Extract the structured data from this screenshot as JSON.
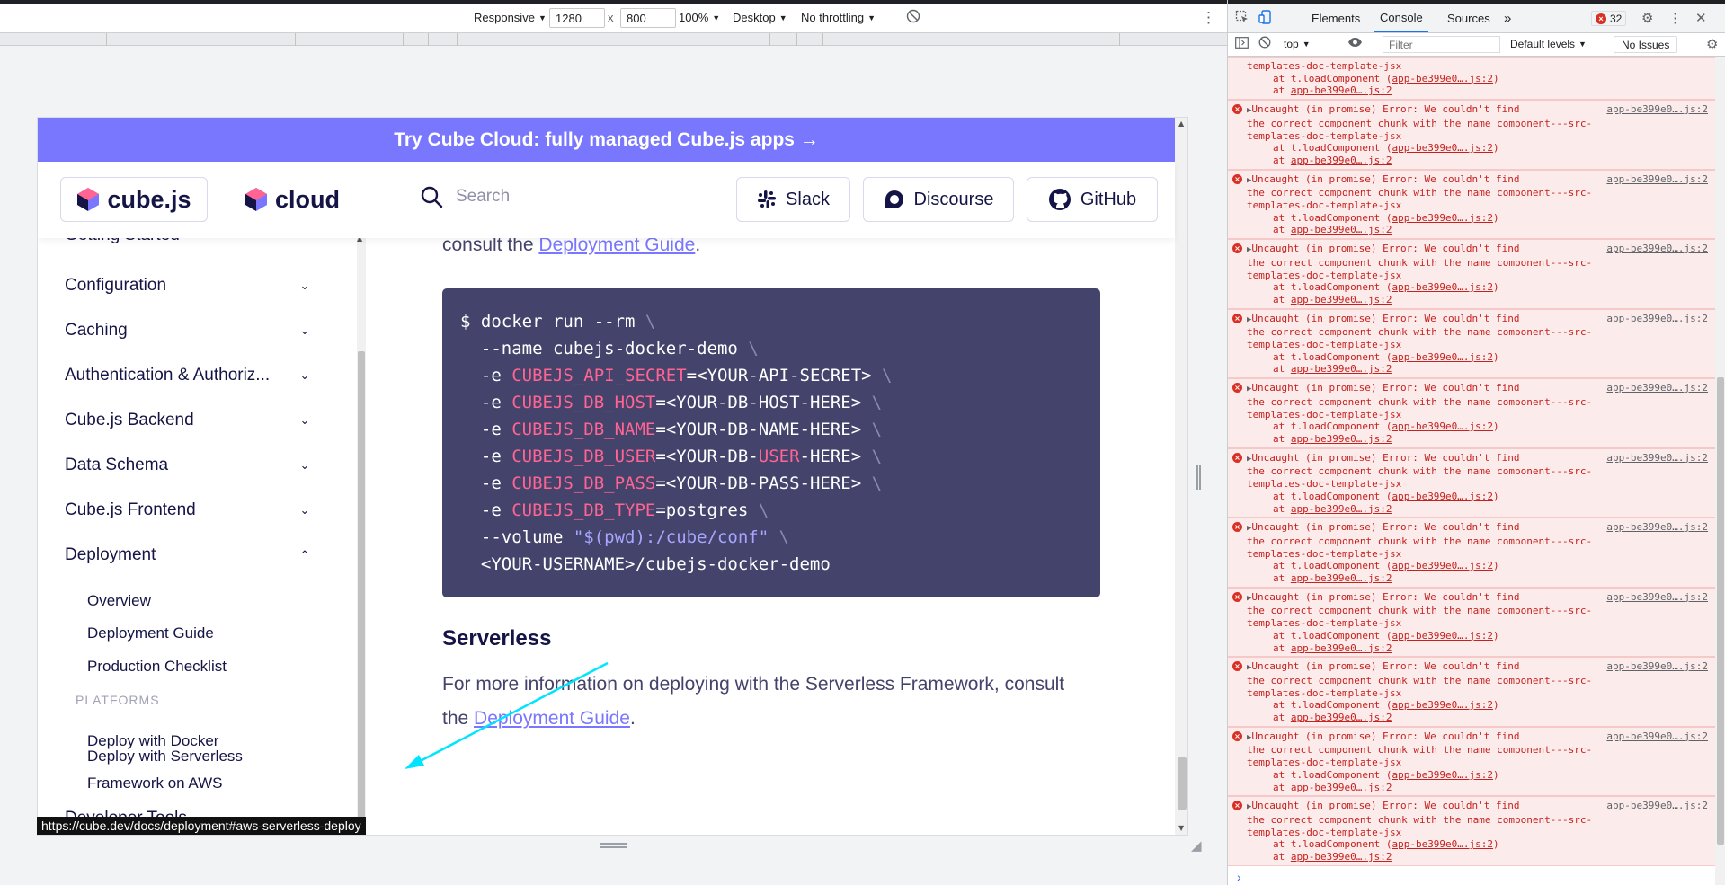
{
  "device_toolbar": {
    "device": "Responsive",
    "width": "1280",
    "height": "800",
    "times": "x",
    "zoom": "100%",
    "mode": "Desktop",
    "throttling": "No throttling"
  },
  "page": {
    "banner": "Try Cube Cloud: fully managed Cube.js apps →",
    "logo_cubejs": "cube.js",
    "logo_cloud": "cloud",
    "search_placeholder": "Search",
    "buttons": {
      "slack": "Slack",
      "discourse": "Discourse",
      "github": "GitHub"
    },
    "sidebar": {
      "cut_top": "Getting Started",
      "items": [
        {
          "label": "Configuration"
        },
        {
          "label": "Caching"
        },
        {
          "label": "Authentication & Authoriz..."
        },
        {
          "label": "Cube.js Backend"
        },
        {
          "label": "Data Schema"
        },
        {
          "label": "Cube.js Frontend"
        },
        {
          "label": "Deployment"
        }
      ],
      "sub_items": [
        "Overview",
        "Deployment Guide",
        "Production Checklist"
      ],
      "platforms_heading": "PLATFORMS",
      "platform_items": [
        "Deploy with Docker",
        "Deploy with Serverless",
        "Framework on AWS"
      ],
      "developer_tools": "Developer Tools"
    },
    "main": {
      "top_para_prefix": "consult the ",
      "top_para_link": "Deployment Guide",
      "top_para_suffix": ".",
      "code": {
        "l1": "$ docker run --rm",
        "bs": "\\",
        "l2": "  --name cubejs-docker-demo",
        "opt_e": "  -e ",
        "env_secret": "CUBEJS_API_SECRET",
        "val_secret": "=<YOUR-API-SECRET>",
        "env_host": "CUBEJS_DB_HOST",
        "val_host": "=<YOUR-DB-HOST-HERE>",
        "env_name": "CUBEJS_DB_NAME",
        "val_name": "=<YOUR-DB-NAME-HERE>",
        "env_user": "CUBEJS_DB_USER",
        "val_user_a": "=<YOUR-DB-",
        "val_user_b": "USER",
        "val_user_c": "-HERE>",
        "env_pass": "CUBEJS_DB_PASS",
        "val_pass": "=<YOUR-DB-PASS-HERE>",
        "env_type": "CUBEJS_DB_TYPE",
        "val_type": "=postgres",
        "vol": "  --volume ",
        "vol_str": "\"$(pwd):/cube/conf\"",
        "last": "  <YOUR-USERNAME>/cubejs-docker-demo"
      },
      "heading": "Serverless",
      "para_text": "For more information on deploying with the Serverless Framework, consult the ",
      "para_link": "Deployment Guide",
      "para_suffix": "."
    },
    "url_tooltip": "https://cube.dev/docs/deployment#aws-serverless-deploy"
  },
  "devtools": {
    "tabs": [
      "Elements",
      "Console",
      "Sources"
    ],
    "active_tab": "Console",
    "more": "»",
    "error_count": "32",
    "context": "top",
    "filter_placeholder": "Filter",
    "levels": "Default levels",
    "no_issues": "No Issues",
    "partial_entry": {
      "l1": "templates-doc-template-jsx",
      "l2_prefix": "at t.loadComponent (",
      "l2_link": "app-be399e0….js:2",
      "l2_suffix": ")",
      "l3_prefix": "at ",
      "l3_link": "app-be399e0….js:2"
    },
    "error_entry": {
      "l1": "Uncaught (in promise) Error: We couldn't find",
      "source": "app-be399e0….js:2",
      "l2": "the correct component chunk with the name component---src-",
      "l3": "templates-doc-template-jsx",
      "l4_prefix": "at t.loadComponent (",
      "l4_link": "app-be399e0….js:2",
      "l4_suffix": ")",
      "l5_prefix": "at ",
      "l5_link": "app-be399e0….js:2"
    },
    "prompt": "›"
  },
  "colors": {
    "banner": "#7a77ff",
    "brand_text": "#141446",
    "code_bg": "#43436b",
    "code_env": "#ff6492",
    "code_string": "#a9a5ff",
    "error_bg": "#fcebeb",
    "error_text": "#c5221f",
    "arrow": "#00e5ff"
  }
}
